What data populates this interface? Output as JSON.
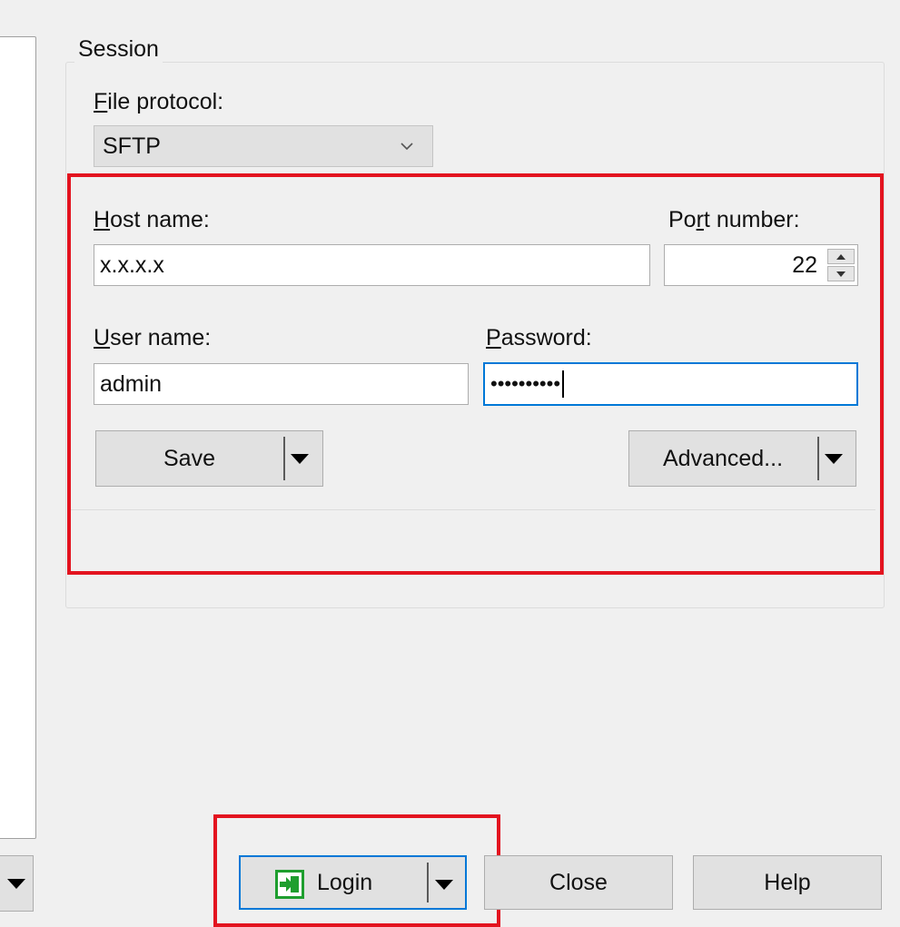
{
  "session": {
    "title": "Session",
    "file_protocol": {
      "label_u": "F",
      "label_rest": "ile protocol:",
      "value": "SFTP"
    },
    "host": {
      "label_u": "H",
      "label_rest": "ost name:",
      "value": "x.x.x.x"
    },
    "port": {
      "label_pre": "Po",
      "label_u": "r",
      "label_rest": "t number:",
      "value": "22"
    },
    "user": {
      "label_u": "U",
      "label_rest": "ser name:",
      "value": "admin"
    },
    "password": {
      "label_u": "P",
      "label_rest": "assword:",
      "value": "••••••••••"
    },
    "save_label": "Save",
    "advanced_label": "Advanced..."
  },
  "footer": {
    "login_label": "Login",
    "close_label": "Close",
    "help_label": "Help"
  },
  "colors": {
    "highlight_red": "#e3131f",
    "focus_blue": "#0078d7",
    "login_icon_green": "#1e9e2e"
  },
  "icons": {
    "login": "login-arrow-icon",
    "dropdown": "dropdown-triangle-icon",
    "combo": "chevron-down-icon"
  }
}
